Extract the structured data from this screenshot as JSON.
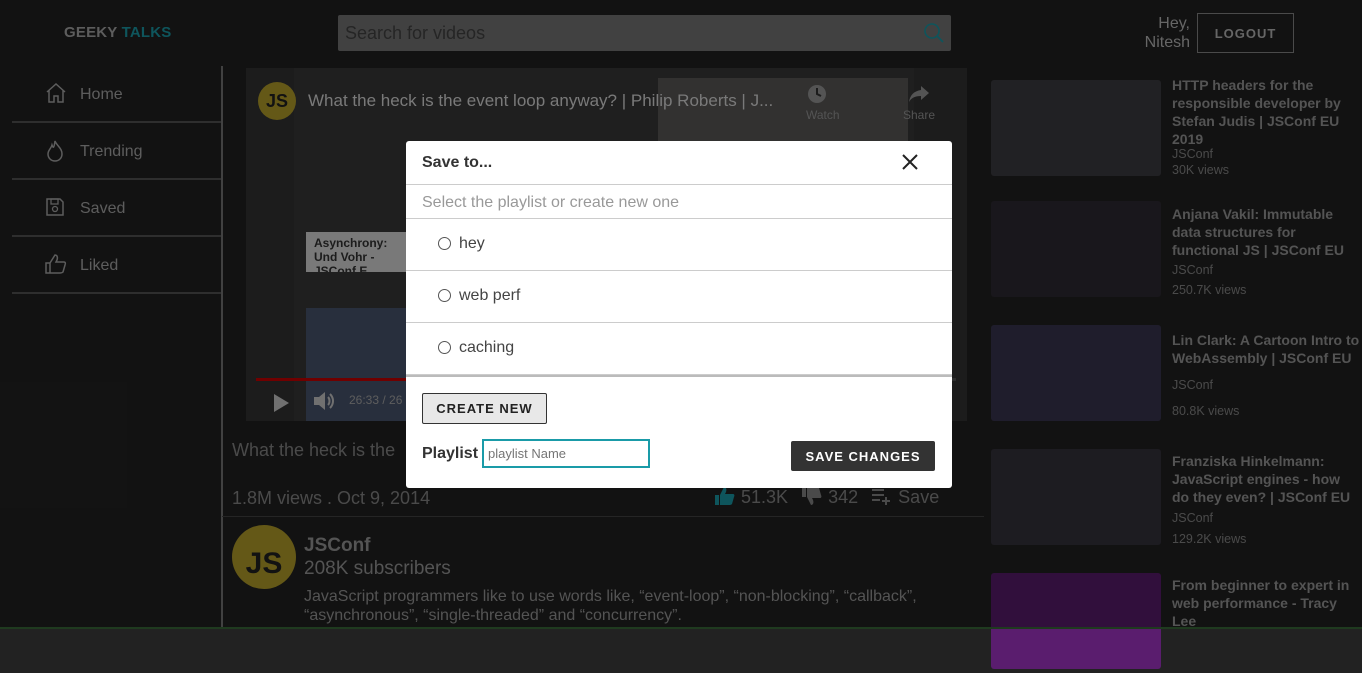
{
  "header": {
    "brand_part1": "GEEKY",
    "brand_part2": "TALKS",
    "search_placeholder": "Search for videos",
    "greeting_line1": "Hey,",
    "greeting_line2": "Nitesh",
    "logout_label": "LOGOUT"
  },
  "sidebar": {
    "items": [
      {
        "label": "Home",
        "icon": "home-icon"
      },
      {
        "label": "Trending",
        "icon": "flame-icon"
      },
      {
        "label": "Saved",
        "icon": "save-icon"
      },
      {
        "label": "Liked",
        "icon": "thumbs-up-icon"
      }
    ]
  },
  "player": {
    "overlay_title": "What the heck is the event loop anyway? | Philip Roberts | J...",
    "watch_later": "Watch",
    "share": "Share",
    "caption": "Asynchrony: Und Vohr - JSConf E",
    "time": "26:33 / 26",
    "progress": 0.25
  },
  "video": {
    "title": "What the heck is the",
    "stats": "1.8M views . Oct 9, 2014",
    "likes": "51.3K",
    "dislikes": "342",
    "save_label": "Save"
  },
  "channel": {
    "logo_text": "JS",
    "name": "JSConf",
    "subscribers": "208K subscribers",
    "description": "JavaScript programmers like to use words like, “event-loop”, “non-blocking”, “callback”, “asynchronous”, “single-threaded” and “concurrency”."
  },
  "suggestions": [
    {
      "title": "HTTP headers for the responsible developer by Stefan Judis | JSConf EU 2019",
      "channel": "JSConf",
      "views": "30K views",
      "thumb_color": "#3d3c42"
    },
    {
      "title": "Anjana Vakil: Immutable data structures for functional JS | JSConf EU",
      "channel": "JSConf",
      "views": "250.7K views",
      "thumb_color": "#2e2b33"
    },
    {
      "title": "Lin Clark: A Cartoon Intro to WebAssembly | JSConf EU",
      "channel": "JSConf",
      "views": "80.8K views",
      "thumb_color": "#3a3550"
    },
    {
      "title": "Franziska Hinkelmann: JavaScript engines - how do they even? | JSConf EU",
      "channel": "JSConf",
      "views": "129.2K views",
      "thumb_color": "#35333d"
    },
    {
      "title": "From beginner to expert in web performance - Tracy Lee",
      "channel": "",
      "views": "",
      "thumb_color": "#5a1d6e"
    }
  ],
  "modal": {
    "title": "Save to...",
    "hint": "Select the playlist or create new one",
    "playlists": [
      "hey",
      "web perf",
      "caching"
    ],
    "create_label": "CREATE NEW",
    "playlist_label": "Playlist",
    "input_placeholder": "playlist Name",
    "save_label": "SAVE CHANGES"
  },
  "colors": {
    "accent": "#1a9ba8",
    "background": "#222222",
    "js_yellow": "#b7a02a"
  }
}
